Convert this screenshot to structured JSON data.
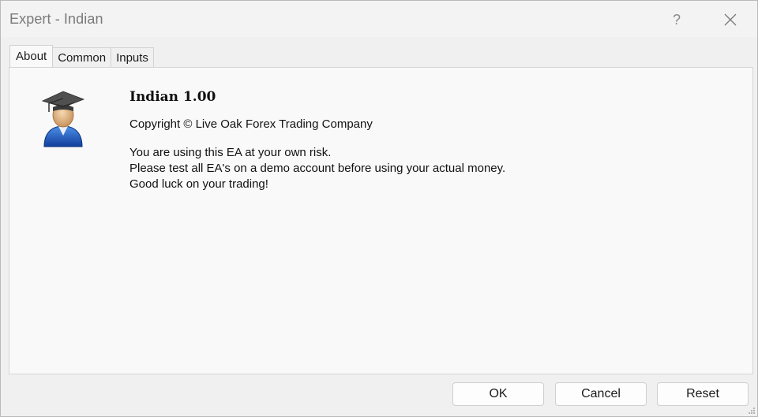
{
  "window": {
    "title": "Expert - Indian",
    "help_label": "?"
  },
  "tabs": [
    {
      "label": "About",
      "active": true
    },
    {
      "label": "Common",
      "active": false
    },
    {
      "label": "Inputs",
      "active": false
    }
  ],
  "about": {
    "ea_title": "Indian 1.00",
    "copyright": "Copyright © Live Oak Forex Trading Company",
    "description_lines": [
      "You are using this EA at your own risk.",
      "Please test all EA's on a demo account before using your actual money.",
      "Good luck on your trading!"
    ],
    "icon": "graduate-user-icon"
  },
  "buttons": {
    "ok": "OK",
    "cancel": "Cancel",
    "reset": "Reset"
  },
  "colors": {
    "accent_blue": "#1f5fbf",
    "title_text": "#7a7a7a"
  }
}
